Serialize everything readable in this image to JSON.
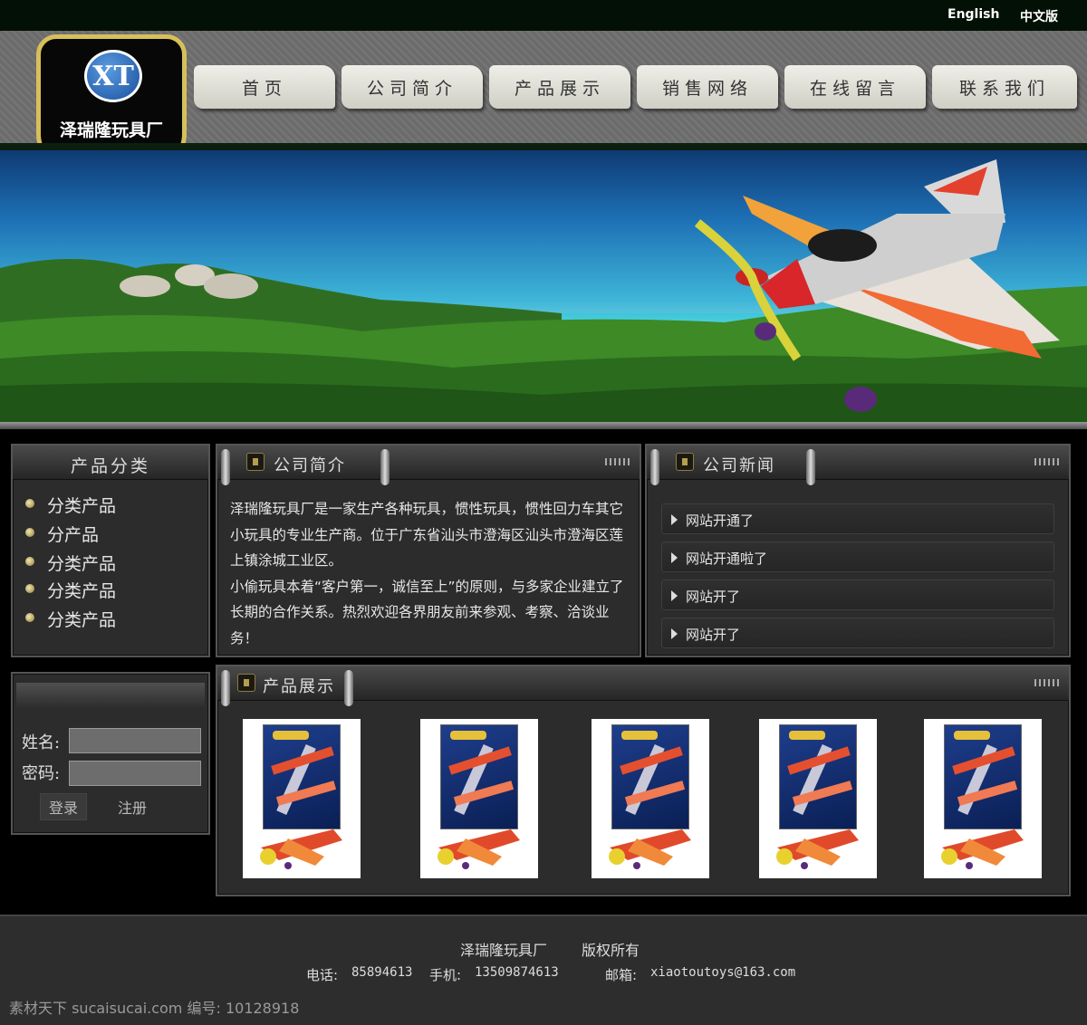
{
  "header": {
    "lang_en": "English",
    "lang_cn": "中文版",
    "logo_mark": "XT",
    "logo_name": "泽瑞隆玩具厂"
  },
  "nav": [
    {
      "label": "首页"
    },
    {
      "label": "公司简介"
    },
    {
      "label": "产品展示"
    },
    {
      "label": "销售网络"
    },
    {
      "label": "在线留言"
    },
    {
      "label": "联系我们"
    }
  ],
  "categories": {
    "title": "产品分类",
    "items": [
      "分类产品",
      "分产品",
      "分类产品",
      "分类产品",
      "分类产品"
    ]
  },
  "intro": {
    "title": "公司简介",
    "paragraph1": "泽瑞隆玩具厂是一家生产各种玩具，惯性玩具，惯性回力车其它小玩具的专业生产商。位于广东省汕头市澄海区汕头市澄海区莲上镇涂城工业区。",
    "paragraph2": "小偷玩具本着“客户第一，诚信至上”的原则，与多家企业建立了长期的合作关系。热烈欢迎各界朋友前来参观、考察、洽谈业务！"
  },
  "news": {
    "title": "公司新闻",
    "items": [
      "网站开通了",
      "网站开通啦了",
      "网站开了",
      "网站开了"
    ]
  },
  "login": {
    "name_label": "姓名:",
    "password_label": "密码:",
    "login_button": "登录",
    "register_button": "注册"
  },
  "products": {
    "title": "产品展示",
    "count": 5
  },
  "footer": {
    "company": "泽瑞隆玩具厂",
    "rights": "版权所有",
    "phone_label": "电话:",
    "phone": "85894613",
    "mobile_label": "手机:",
    "mobile": "13509874613",
    "email_label": "邮箱:",
    "email": "xiaotoutoys@163.com",
    "watermark": "素材天下 sucaisucai.com  编号: 10128918"
  },
  "colors": {
    "logo_border": "#d7c05a",
    "background": "#000000",
    "panel": "#2c2c2c"
  }
}
